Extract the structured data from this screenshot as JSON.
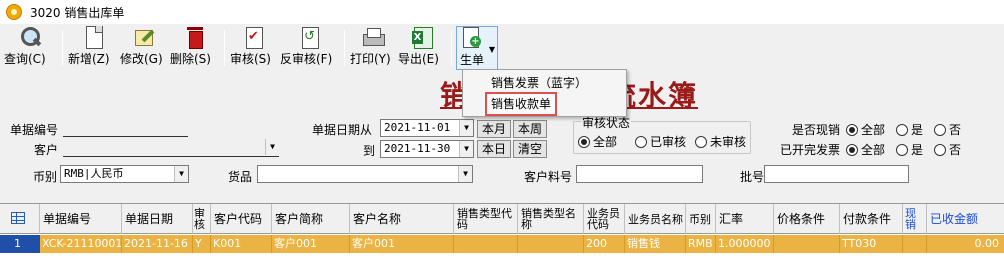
{
  "window": {
    "title": "3020 销售出库单"
  },
  "toolbar": {
    "query": "查询(C)",
    "add": "新增(Z)",
    "edit": "修改(G)",
    "delete": "删除(S)",
    "audit": "审核(S)",
    "unaudit": "反审核(F)",
    "print": "打印(Y)",
    "export": "导出(E)",
    "generate": "生单"
  },
  "report_title": {
    "left": "销",
    "right": "流水簿"
  },
  "gen_menu": {
    "items": [
      "销售发票（蓝字）",
      "销售收款单"
    ],
    "highlighted_index": 1
  },
  "filters": {
    "doc_no_label": "单据编号",
    "doc_no_value": "",
    "customer_label": "客户",
    "customer_value": "",
    "currency_label": "币别",
    "currency_value": "RMB|人民币",
    "date_from_label": "单据日期从",
    "date_from_value": "2021-11-01",
    "date_to_label": "到",
    "date_to_value": "2021-11-30",
    "btn_this_month": "本月",
    "btn_this_week": "本周",
    "btn_today": "本日",
    "btn_clear": "清空",
    "goods_label": "货品",
    "goods_value": "",
    "cust_material_label": "客户料号",
    "cust_material_value": "",
    "batch_label": "批号",
    "batch_value": "",
    "audit_status": {
      "title": "审核状态",
      "options": [
        "全部",
        "已审核",
        "未审核"
      ],
      "selected": 0
    },
    "cash_sale": {
      "label": "是否现销",
      "options": [
        "全部",
        "是",
        "否"
      ],
      "selected": 0
    },
    "invoiced": {
      "label": "已开完发票",
      "options": [
        "全部",
        "是",
        "否"
      ],
      "selected": 0
    }
  },
  "grid": {
    "columns": [
      "单据编号",
      "单据日期",
      "审核",
      "客户代码",
      "客户简称",
      "客户名称",
      "销售类型代码",
      "销售类型名称",
      "业务员代码",
      "业务员名称",
      "币别",
      "汇率",
      "价格条件",
      "付款条件",
      "现销",
      "已收金额"
    ],
    "rows": [
      {
        "row_no": "1",
        "cells": [
          "XCK-21110001",
          "2021-11-16",
          "Y",
          "K001",
          "客户001",
          "客户001",
          "",
          "",
          "200",
          "销售钱",
          "RMB",
          "1.000000",
          "",
          "TT030",
          "",
          "0.00"
        ]
      }
    ]
  },
  "colors": {
    "row_highlight": "#eab343",
    "title_red": "#9a1a1a",
    "menu_outline": "#e05050"
  }
}
